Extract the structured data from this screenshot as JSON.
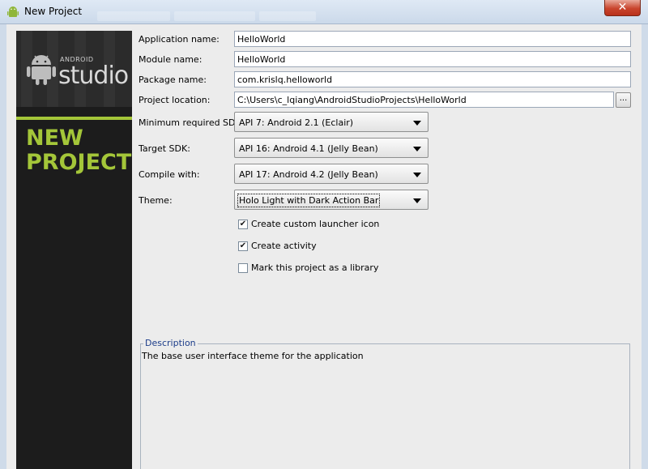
{
  "window": {
    "title": "New Project",
    "close_glyph": "✕"
  },
  "banner": {
    "android_text": "ANDROID",
    "studio_text": "studio",
    "new_text": "NEW",
    "project_text": "PROJECT"
  },
  "form": {
    "application_name": {
      "label": "Application name:",
      "value": "HelloWorld"
    },
    "module_name": {
      "label": "Module name:",
      "value": "HelloWorld"
    },
    "package_name": {
      "label": "Package name:",
      "value": "com.krislq.helloworld"
    },
    "project_location": {
      "label": "Project location:",
      "value": "C:\\Users\\c_lqiang\\AndroidStudioProjects\\HelloWorld",
      "browse_label": "..."
    },
    "min_sdk": {
      "label": "Minimum required SDK:",
      "value": "API 7: Android 2.1 (Eclair)"
    },
    "target_sdk": {
      "label": "Target SDK:",
      "value": "API 16: Android 4.1 (Jelly Bean)"
    },
    "compile_with": {
      "label": "Compile with:",
      "value": "API 17: Android 4.2 (Jelly Bean)"
    },
    "theme": {
      "label": "Theme:",
      "value": "Holo Light with Dark Action Bar"
    }
  },
  "checkboxes": [
    {
      "label": "Create custom launcher icon",
      "checked": true
    },
    {
      "label": "Create activity",
      "checked": true
    },
    {
      "label": "Mark this project as a library",
      "checked": false
    }
  ],
  "description": {
    "legend": "Description",
    "text": "The base user interface theme for the application"
  },
  "colors": {
    "android_green": "#a4c639",
    "banner_dark": "#1c1c1c",
    "legend_blue": "#1c3d8a"
  }
}
